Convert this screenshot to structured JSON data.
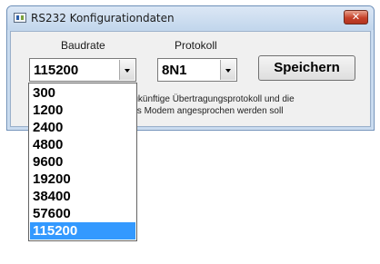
{
  "window": {
    "title": "RS232 Konfigurationdaten",
    "close_label": "✕",
    "icons": {
      "app": "rs232-app-icon",
      "close": "close-icon"
    }
  },
  "labels": {
    "baudrate": "Baudrate",
    "protokoll": "Protokoll"
  },
  "baudrate": {
    "selected": "115200",
    "options": [
      "300",
      "1200",
      "2400",
      "4800",
      "9600",
      "19200",
      "38400",
      "57600",
      "115200"
    ],
    "highlighted": "115200"
  },
  "protokoll": {
    "selected": "8N1"
  },
  "save_button": {
    "label": "Speichern"
  },
  "description": {
    "line1": "as zukünftige Übertragungsprotokoll und die",
    "line2": "er das Modem angesprochen werden soll"
  },
  "colors": {
    "selection": "#3399ff",
    "titlebar": "#c6d9ee",
    "close": "#c6412a"
  }
}
